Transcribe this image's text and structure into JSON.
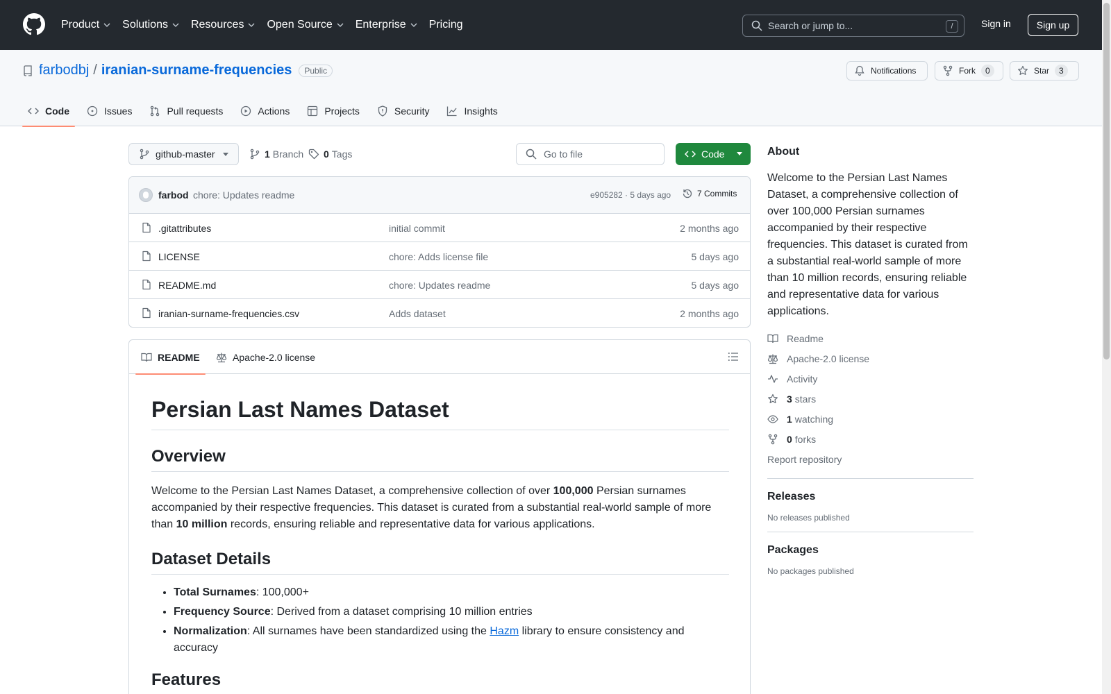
{
  "header": {
    "nav": [
      {
        "label": "Product",
        "has_menu": true
      },
      {
        "label": "Solutions",
        "has_menu": true
      },
      {
        "label": "Resources",
        "has_menu": true
      },
      {
        "label": "Open Source",
        "has_menu": true
      },
      {
        "label": "Enterprise",
        "has_menu": true
      },
      {
        "label": "Pricing",
        "has_menu": false
      }
    ],
    "search_placeholder": "Search or jump to...",
    "search_shortcut": "/",
    "sign_in": "Sign in",
    "sign_up": "Sign up"
  },
  "repo": {
    "owner": "farbodbj",
    "separator": "/",
    "name": "iranian-surname-frequencies",
    "visibility": "Public",
    "notifications_label": "Notifications",
    "fork_label": "Fork",
    "fork_count": "0",
    "star_label": "Star",
    "star_count": "3"
  },
  "tabs": [
    "Code",
    "Issues",
    "Pull requests",
    "Actions",
    "Projects",
    "Security",
    "Insights"
  ],
  "toolbar": {
    "branch": "github-master",
    "branch_count": "1",
    "branch_label": "Branch",
    "tag_count": "0",
    "tag_label": "Tags",
    "go_to_file": "Go to file",
    "code_button": "Code"
  },
  "latest_commit": {
    "author": "farbod",
    "message": "chore: Updates readme",
    "hash_time": "e905282 · 5 days ago",
    "commits": "7 Commits"
  },
  "files": [
    {
      "name": ".gitattributes",
      "message": "initial commit",
      "time": "2 months ago"
    },
    {
      "name": "LICENSE",
      "message": "chore: Adds license file",
      "time": "5 days ago"
    },
    {
      "name": "README.md",
      "message": "chore: Updates readme",
      "time": "5 days ago"
    },
    {
      "name": "iranian-surname-frequencies.csv",
      "message": "Adds dataset",
      "time": "2 months ago"
    }
  ],
  "readme": {
    "tab_readme": "README",
    "tab_license": "Apache-2.0 license",
    "title": "Persian Last Names Dataset",
    "h_overview": "Overview",
    "overview": {
      "p1": "Welcome to the Persian Last Names Dataset, a comprehensive collection of over ",
      "b1": "100,000",
      "p2": " Persian surnames accompanied by their respective frequencies. This dataset is curated from a substantial real-world sample of more than ",
      "b2": "10 million",
      "p3": " records, ensuring reliable and representative data for various applications."
    },
    "h_details": "Dataset Details",
    "details": [
      {
        "label": "Total Surnames",
        "text": ": 100,000+"
      },
      {
        "label": "Frequency Source",
        "text": ": Derived from a dataset comprising 10 million entries"
      },
      {
        "label": "Normalization",
        "text": ": All surnames have been standardized using the ",
        "link": "Hazm",
        "text2": " library to ensure consistency and accuracy"
      }
    ],
    "h_features": "Features"
  },
  "sidebar": {
    "about_title": "About",
    "about_text": "Welcome to the Persian Last Names Dataset, a comprehensive collection of over 100,000 Persian surnames accompanied by their respective frequencies. This dataset is curated from a substantial real-world sample of more than 10 million records, ensuring reliable and representative data for various applications.",
    "readme": "Readme",
    "license": "Apache-2.0 license",
    "activity": "Activity",
    "stars_count": "3",
    "stars_label": "stars",
    "watching_count": "1",
    "watching_label": "watching",
    "forks_count": "0",
    "forks_label": "forks",
    "report": "Report repository",
    "releases_title": "Releases",
    "releases_text": "No releases published",
    "packages_title": "Packages",
    "packages_text": "No packages published"
  },
  "colors": {
    "header_bg": "#24292f",
    "link": "#0969da",
    "primary_green": "#1f883d",
    "tab_underline": "#fd8c73"
  }
}
